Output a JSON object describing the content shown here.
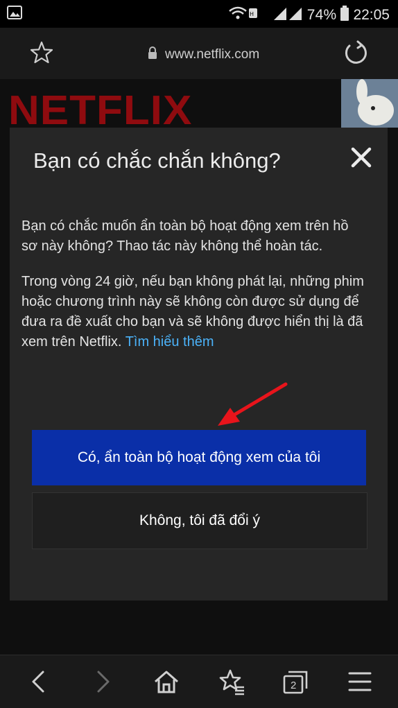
{
  "status_bar": {
    "battery_percent": "74%",
    "time": "22:05"
  },
  "browser": {
    "url": "www.netflix.com",
    "tab_count": "2"
  },
  "page": {
    "logo_text": "NETFLIX"
  },
  "dialog": {
    "title": "Bạn có chắc chắn không?",
    "paragraph1": "Bạn có chắc muốn ẩn toàn bộ hoạt động xem trên hồ sơ này không? Thao tác này không thể hoàn tác.",
    "paragraph2": "Trong vòng 24 giờ, nếu bạn không phát lại, những phim hoặc chương trình này sẽ không còn được sử dụng để đưa ra đề xuất cho bạn và sẽ không được hiển thị là đã xem trên Netflix.",
    "learn_more": "Tìm hiểu thêm",
    "confirm_label": "Có, ẩn toàn bộ hoạt động xem của tôi",
    "cancel_label": "Không, tôi đã đổi ý"
  },
  "colors": {
    "primary_button": "#0a2fa8",
    "link": "#4bb2f9",
    "netflix_red": "#8f0b0f",
    "arrow": "#e8141b"
  }
}
